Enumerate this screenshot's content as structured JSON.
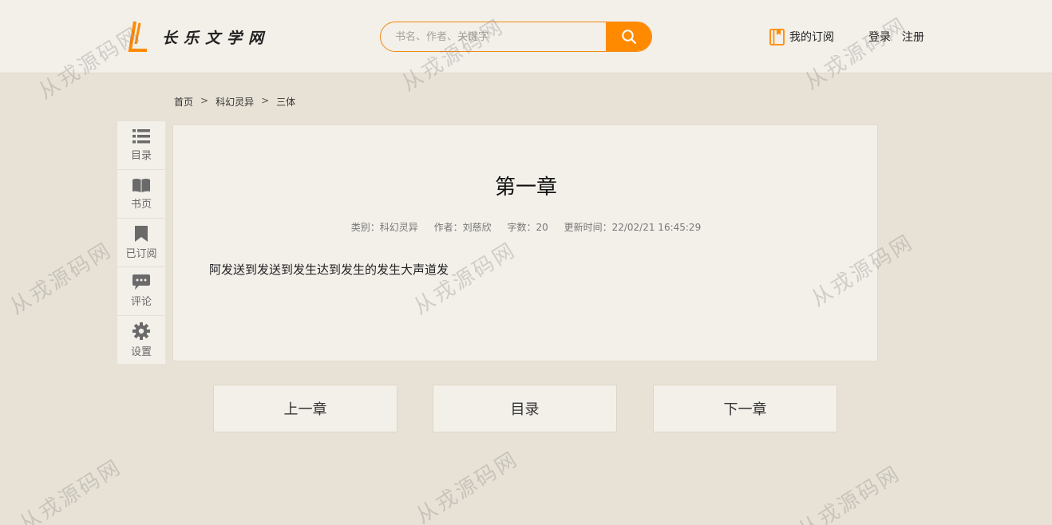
{
  "header": {
    "logo_text": "长乐文学网",
    "search": {
      "placeholder": "书名、作者、关键字"
    },
    "subscriptions_label": "我的订阅",
    "login_label": "登录",
    "register_label": "注册",
    "accent_color": "#ff8a00"
  },
  "breadcrumb": {
    "items": [
      "首页",
      "科幻灵异"
    ],
    "current": "三体",
    "separator": ">"
  },
  "toolbar": {
    "items": [
      {
        "icon": "list-icon",
        "label": "目录"
      },
      {
        "icon": "book-icon",
        "label": "书页"
      },
      {
        "icon": "bookmark-icon",
        "label": "已订阅"
      },
      {
        "icon": "comment-icon",
        "label": "评论"
      },
      {
        "icon": "gear-icon",
        "label": "设置"
      }
    ]
  },
  "chapter": {
    "title": "第一章",
    "category": "类别：科幻灵异",
    "author": "作者：刘慈欣",
    "word_count": "字数：20",
    "updated": "更新时间：22/02/21 16:45:29",
    "content": "阿发送到发送到发生达到发生的发生大声道发"
  },
  "navigation": {
    "prev_label": "上一章",
    "toc_label": "目录",
    "next_label": "下一章"
  },
  "watermark": "从戎源码网"
}
